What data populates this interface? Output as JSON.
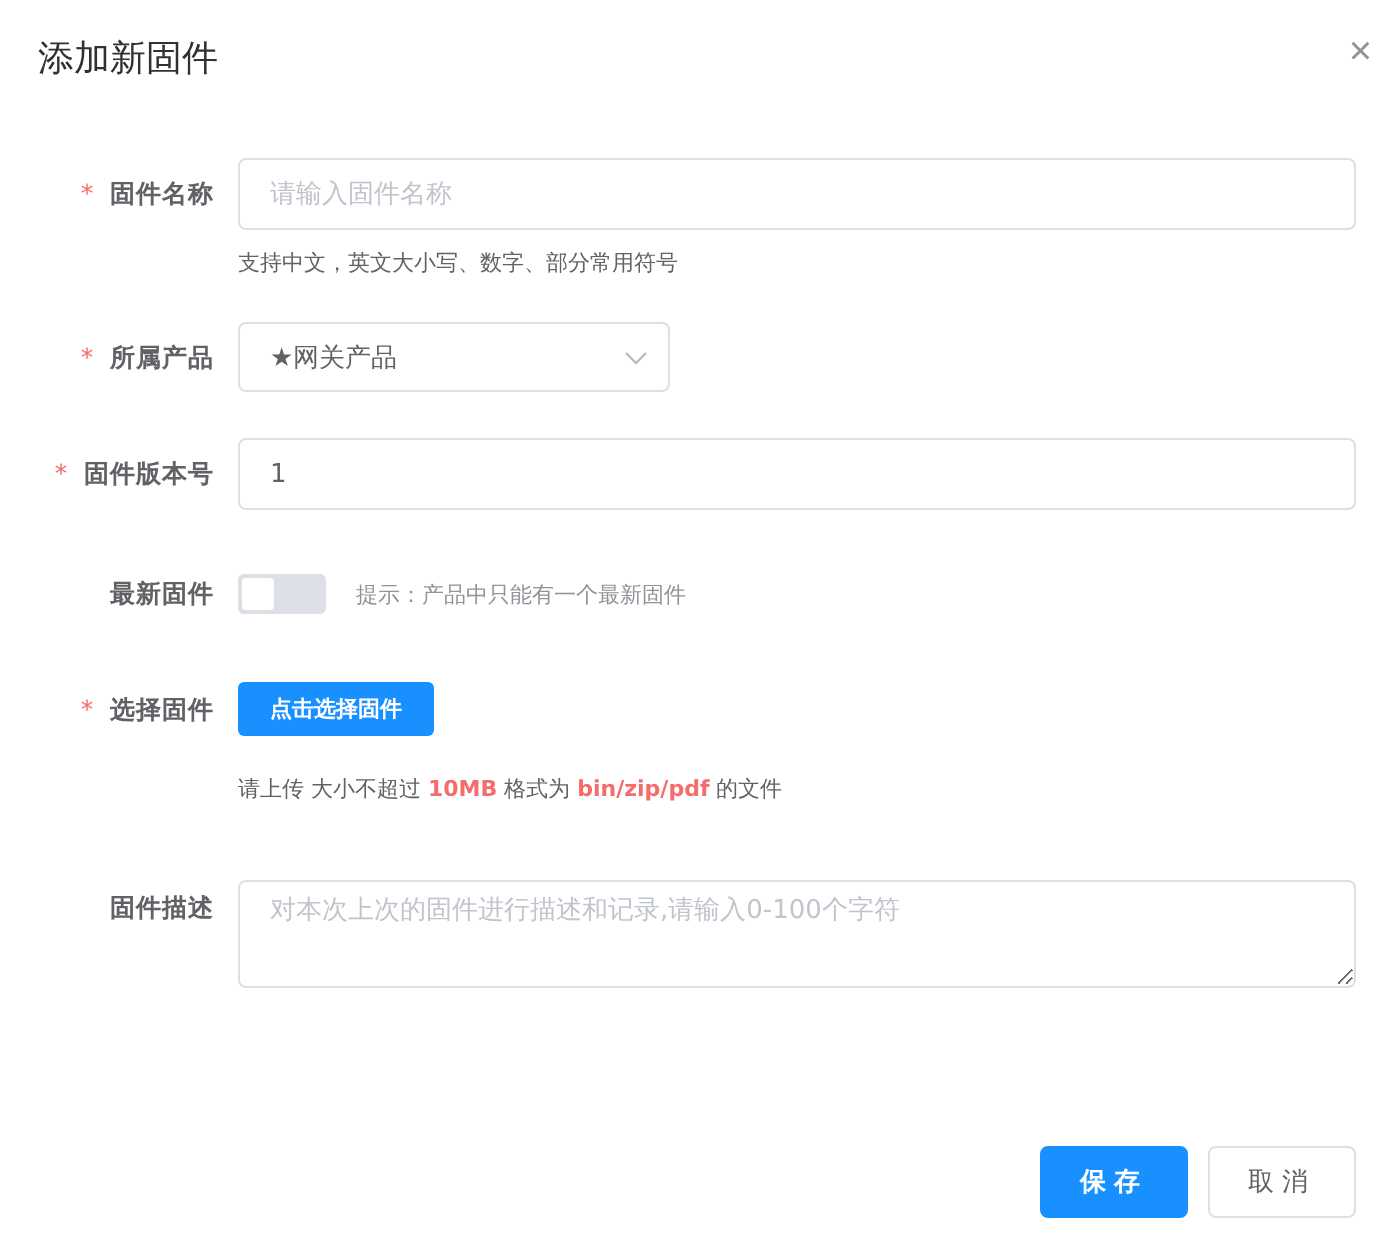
{
  "dialog": {
    "title": "添加新固件",
    "close": "×"
  },
  "fields": [
    {
      "kind": "input",
      "label": "固件名称",
      "required_mark": "*",
      "placeholder": "请输入固件名称",
      "hint": "支持中文，英文大小写、数字、部分常用符号"
    },
    {
      "kind": "select",
      "label": "所属产品",
      "required_mark": "*",
      "value": "★网关产品"
    },
    {
      "kind": "input",
      "label": "固件版本号",
      "required_mark": "*",
      "value": "1"
    },
    {
      "kind": "switch",
      "label": "最新固件",
      "on": false,
      "tip": "提示：产品中只能有一个最新固件"
    },
    {
      "kind": "upload",
      "label": "选择固件",
      "required_mark": "*",
      "button": "点击选择固件",
      "hint": "请上传 大小不超过 **10MB** 格式为 **bin/zip/pdf** 的文件"
    },
    {
      "kind": "textarea",
      "label": "固件描述",
      "placeholder": "对本次上次的固件进行描述和记录,请输入0-100个字符"
    }
  ],
  "buttons": [
    {
      "label": "保存",
      "primary": true
    },
    {
      "label": "取消",
      "primary": false
    }
  ]
}
